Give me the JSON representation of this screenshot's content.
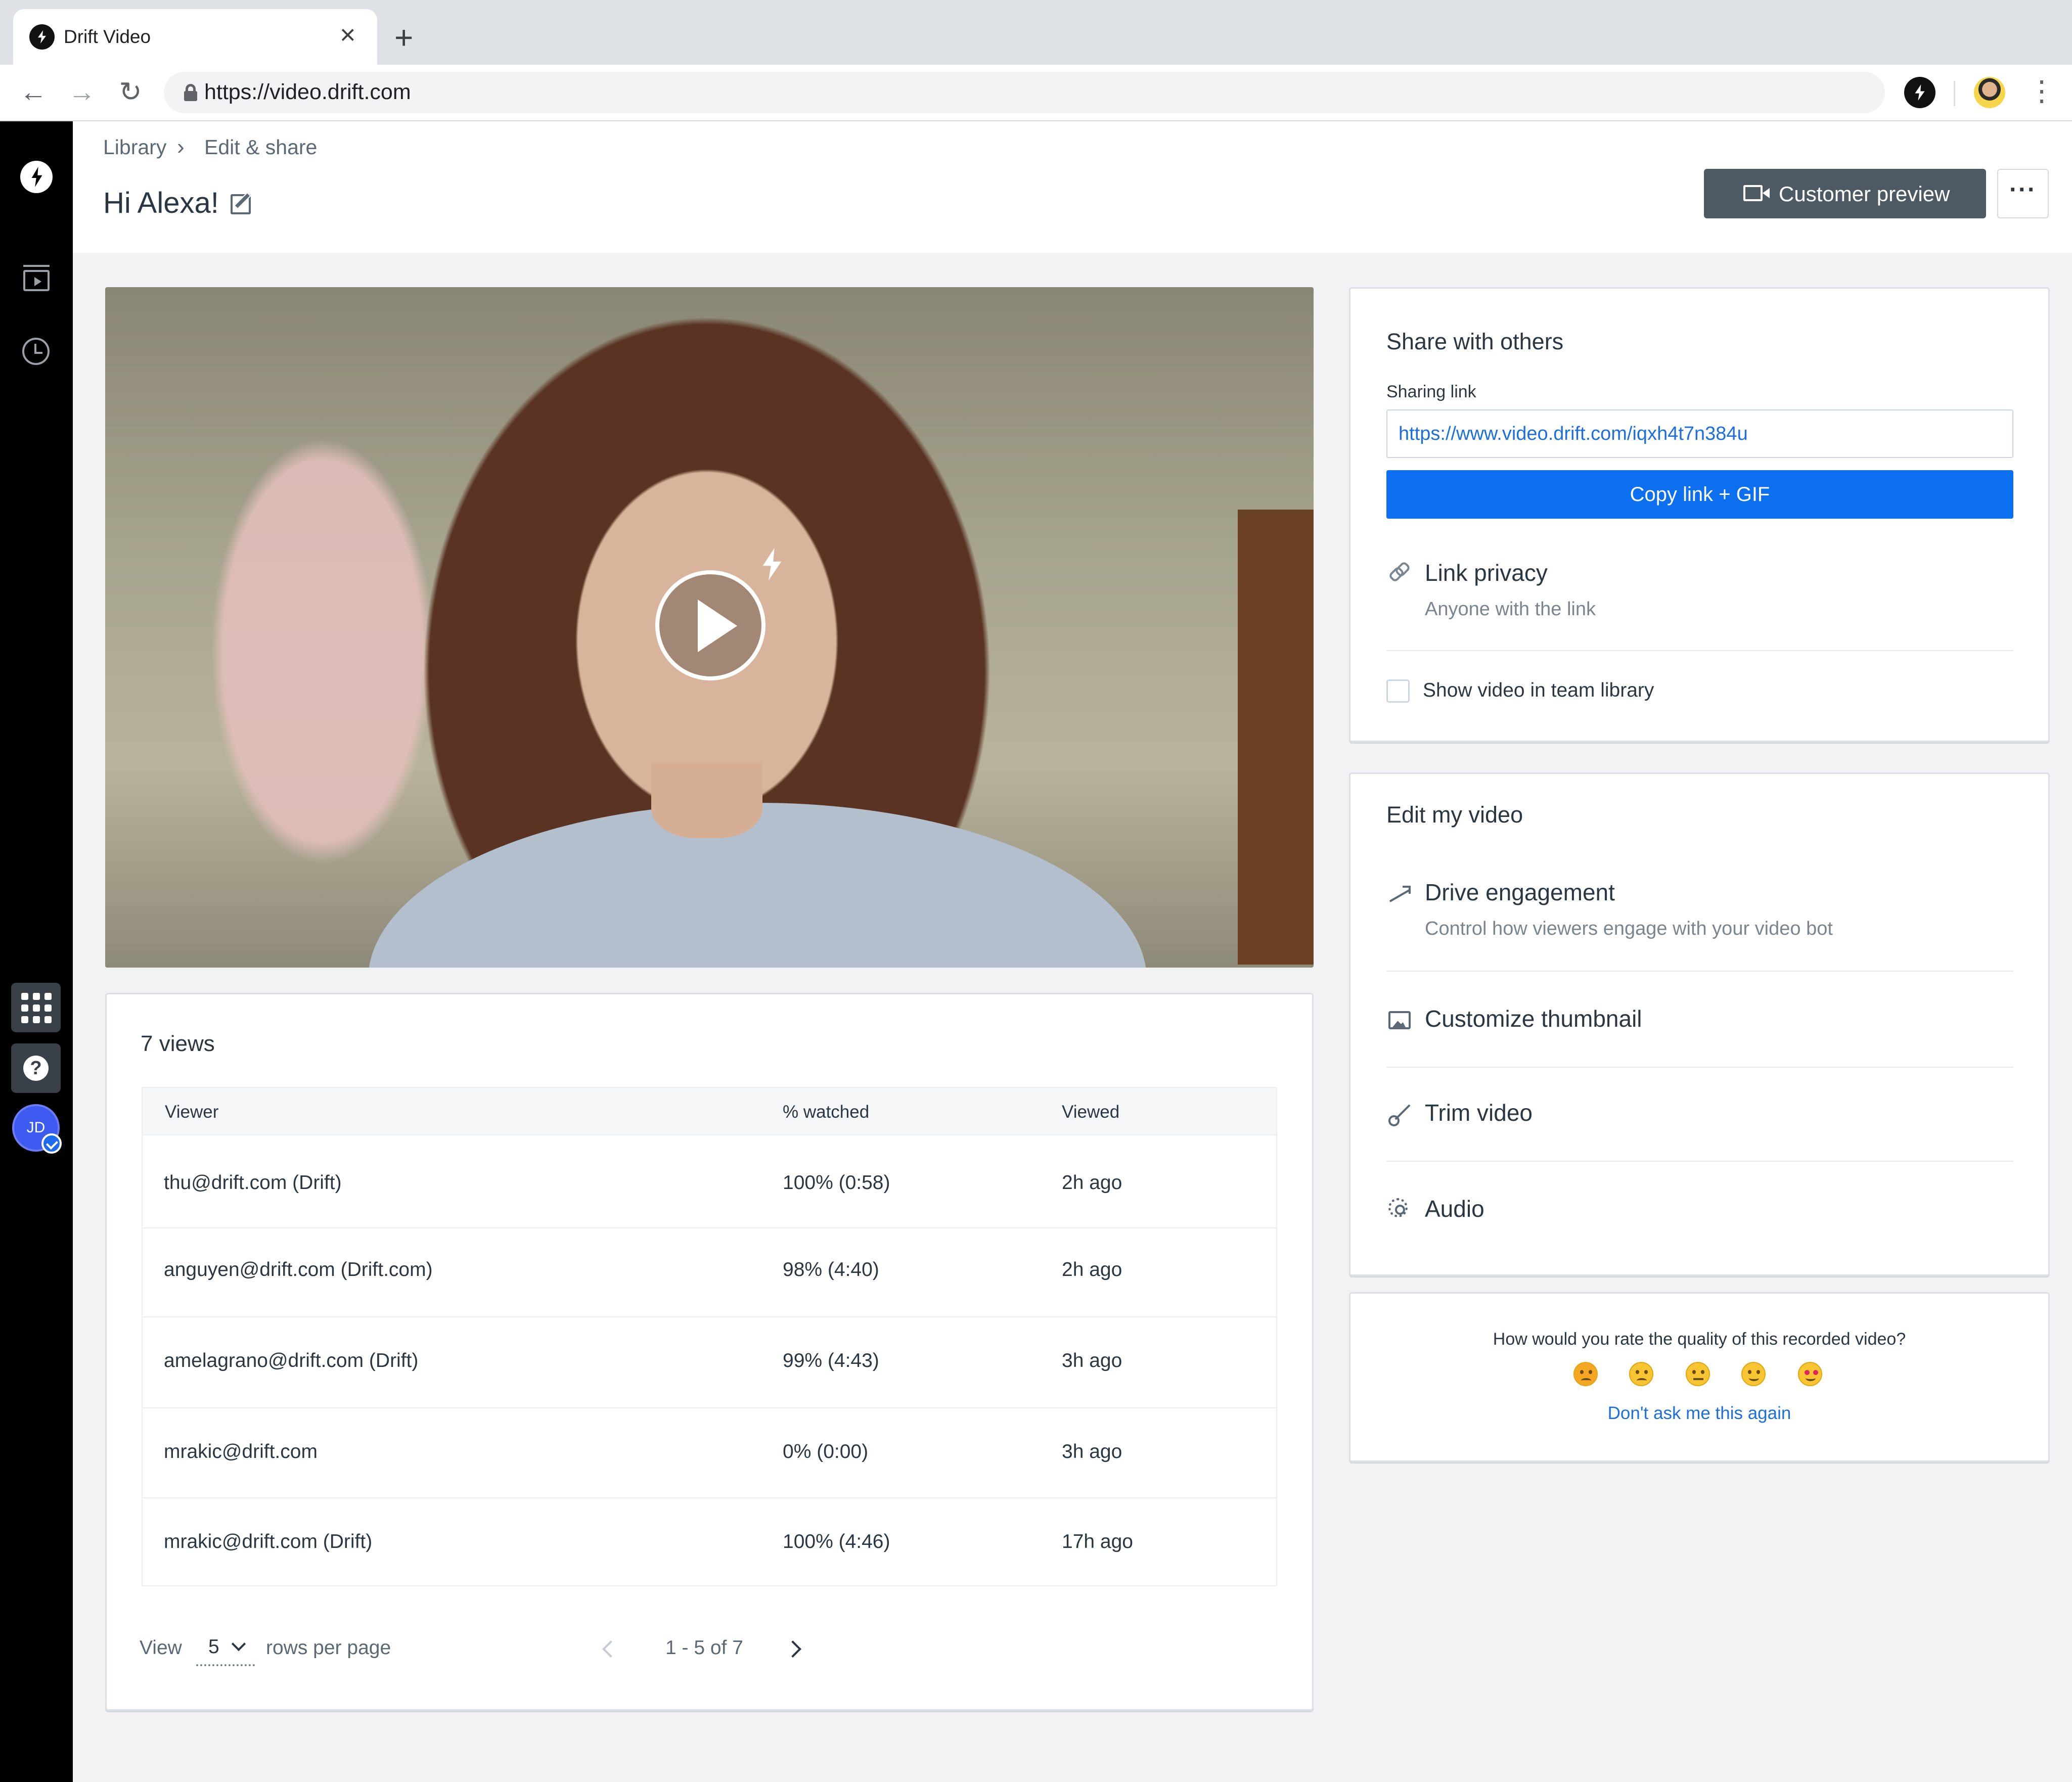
{
  "browser": {
    "tab_title": "Drift Video",
    "tab_close": "×",
    "new_tab": "+",
    "url": "https://video.drift.com"
  },
  "sidebar": {
    "avatar_initials": "JD"
  },
  "header": {
    "breadcrumb": [
      "Library",
      "Edit & share"
    ],
    "breadcrumb_sep": "›",
    "title": "Hi Alexa!",
    "preview_button": "Customer preview",
    "more_button": "···"
  },
  "views": {
    "title": "7 views",
    "columns": [
      "Viewer",
      "% watched",
      "Viewed"
    ],
    "rows": [
      [
        "thu@drift.com (Drift)",
        "100% (0:58)",
        "2h ago"
      ],
      [
        "anguyen@drift.com (Drift.com)",
        "98% (4:40)",
        "2h ago"
      ],
      [
        "amelagrano@drift.com (Drift)",
        "99% (4:43)",
        "3h ago"
      ],
      [
        "mrakic@drift.com",
        "0% (0:00)",
        "3h ago"
      ],
      [
        "mrakic@drift.com (Drift)",
        "100% (4:46)",
        "17h ago"
      ]
    ],
    "pagination": {
      "view_label": "View",
      "rows_per_page": "5",
      "rows_label": "rows per page",
      "range": "1 - 5 of 7"
    }
  },
  "share": {
    "title": "Share with others",
    "sharing_link_label": "Sharing link",
    "sharing_link": "https://www.video.drift.com/iqxh4t7n384u",
    "copy_button": "Copy link + GIF",
    "privacy_title": "Link privacy",
    "privacy_value": "Anyone with the link",
    "team_library_label": "Show video in team library"
  },
  "edit": {
    "title": "Edit my video",
    "items": [
      {
        "label": "Drive engagement",
        "sub": "Control how viewers engage with your video bot"
      },
      {
        "label": "Customize thumbnail"
      },
      {
        "label": "Trim video"
      },
      {
        "label": "Audio"
      }
    ]
  },
  "rating": {
    "question": "How would you rate the quality of this recorded video?",
    "dont_ask": "Don't ask me this again"
  }
}
